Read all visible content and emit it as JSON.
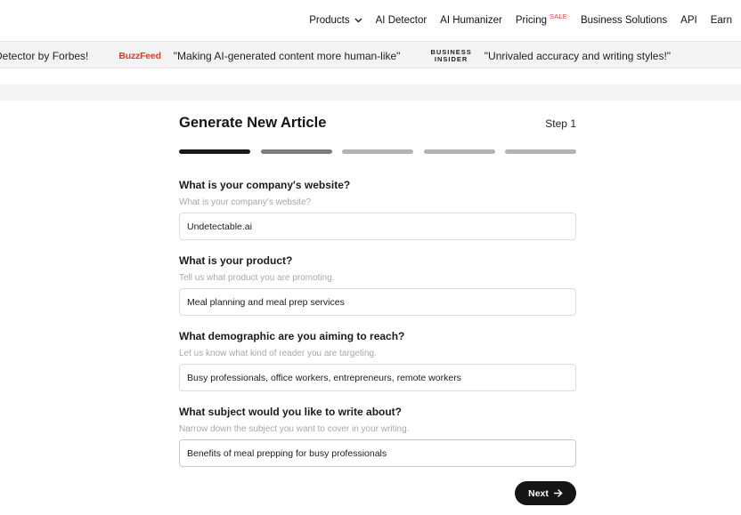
{
  "nav": {
    "items": [
      {
        "label": "Products",
        "has_dropdown": true
      },
      {
        "label": "AI Detector"
      },
      {
        "label": "AI Humanizer"
      },
      {
        "label": "Pricing",
        "badge": "SALE"
      },
      {
        "label": "Business Solutions"
      },
      {
        "label": "API"
      },
      {
        "label": "Earn"
      }
    ],
    "icons": {
      "dropdown": "chevron-down-icon"
    }
  },
  "press": {
    "quote_1": "Detector by Forbes!",
    "logo_1": "BuzzFeed",
    "quote_2": "\"Making AI-generated content more human-like\"",
    "logo_2_line1": "BUSINESS",
    "logo_2_line2": "INSIDER",
    "quote_3": "\"Unrivaled accuracy and writing styles!\""
  },
  "form": {
    "title": "Generate New Article",
    "step": "Step 1",
    "progress": {
      "total_steps": 5,
      "current_step": 1
    },
    "fields": [
      {
        "label": "What is your company's website?",
        "hint": "What is your company's website?",
        "value": "Undetectable.ai"
      },
      {
        "label": "What is your product?",
        "hint": "Tell us what product you are promoting.",
        "value": "Meal planning and meal prep services"
      },
      {
        "label": "What demographic are you aiming to reach?",
        "hint": "Let us know what kind of reader you are targeting.",
        "value": "Busy professionals, office workers, entrepreneurs, remote workers"
      },
      {
        "label": "What subject would you like to write about?",
        "hint": "Narrow down the subject you want to cover in your writing.",
        "value": "Benefits of meal prepping for busy professionals"
      }
    ],
    "next_label": "Next",
    "icons": {
      "next": "arrow-right-icon"
    }
  },
  "colors": {
    "accent": "#161616",
    "sale": "#e23b3b",
    "buzzfeed": "#e8352a",
    "strip": "#f3f3f3"
  }
}
